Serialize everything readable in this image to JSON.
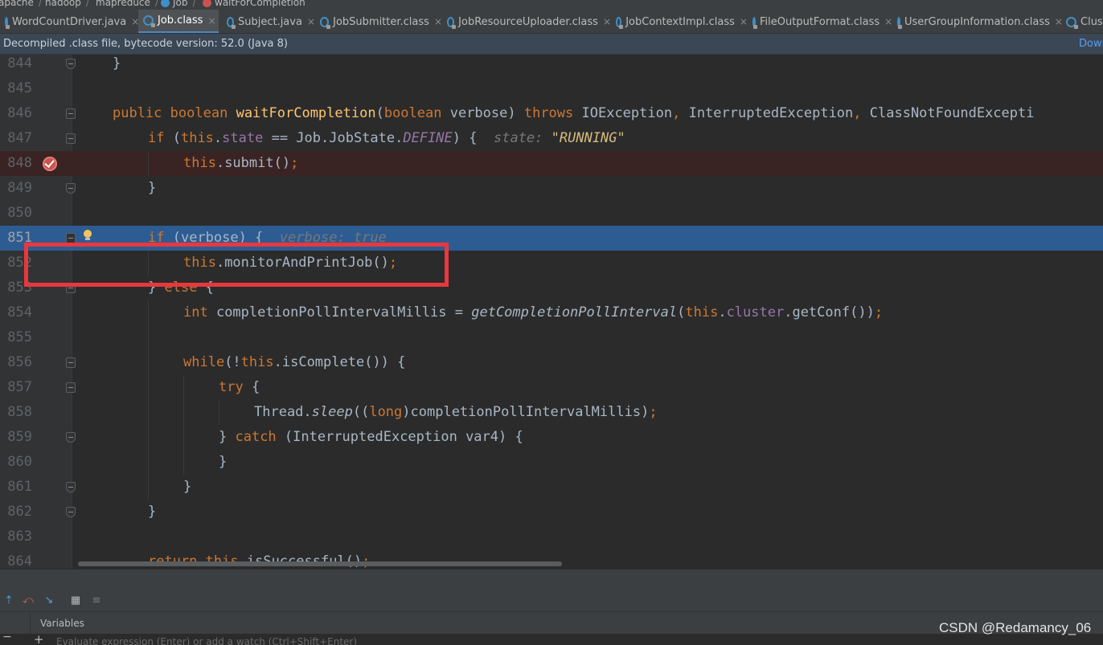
{
  "breadcrumb": {
    "items": [
      "apache",
      "hadoop",
      "mapreduce",
      "Job",
      "waitForCompletion"
    ]
  },
  "tabs": [
    {
      "label": "WordCountDriver.java",
      "active": false
    },
    {
      "label": "Job.class",
      "active": true
    },
    {
      "label": "Subject.java",
      "active": false
    },
    {
      "label": "JobSubmitter.class",
      "active": false
    },
    {
      "label": "JobResourceUploader.class",
      "active": false
    },
    {
      "label": "JobContextImpl.class",
      "active": false
    },
    {
      "label": "FileOutputFormat.class",
      "active": false
    },
    {
      "label": "UserGroupInformation.class",
      "active": false
    },
    {
      "label": "Clus",
      "active": false
    }
  ],
  "tab_close_glyph": "×",
  "infobar": {
    "message": "Decompiled .class file, bytecode version: 52.0 (Java 8)",
    "link": "Down"
  },
  "editor": {
    "line_numbers": [
      "844",
      "845",
      "846",
      "847",
      "848",
      "849",
      "850",
      "851",
      "852",
      "853",
      "854",
      "855",
      "856",
      "857",
      "858",
      "859",
      "860",
      "861",
      "862",
      "863",
      "864"
    ],
    "breakpoint_line": "848",
    "current_line": "851"
  },
  "code": {
    "l844": [
      "}"
    ],
    "l846": [
      "public",
      " ",
      "boolean",
      " ",
      "waitForCompletion",
      "(",
      "boolean",
      " verbose) ",
      "throws",
      " IOException",
      ", ",
      "InterruptedException",
      ", ",
      "ClassNotFoundExcepti"
    ],
    "l847": [
      "if",
      " (",
      "this",
      ".",
      "state",
      " == Job.JobState.",
      "DEFINE",
      ") {",
      "state: ",
      "\"RUNNING\""
    ],
    "l848": [
      "this",
      ".submit()",
      ";"
    ],
    "l849": [
      "}"
    ],
    "l851": [
      "if",
      " (verbose) {",
      "verbose: true"
    ],
    "l852": [
      "this",
      ".monitorAndPrintJob()",
      ";"
    ],
    "l853": [
      "} ",
      "else",
      " {"
    ],
    "l854": [
      "int",
      " completionPollIntervalMillis = ",
      "getCompletionPollInterval",
      "(",
      "this",
      ".",
      "cluster",
      ".getConf())",
      ";"
    ],
    "l856": [
      "while",
      "(!",
      "this",
      ".isComplete()) {"
    ],
    "l857": [
      "try",
      " {"
    ],
    "l858": [
      "Thread.",
      "sleep",
      "((",
      "long",
      ")completionPollIntervalMillis)",
      ";"
    ],
    "l859": [
      "} ",
      "catch",
      " (InterruptedException var4) {"
    ],
    "l860": [
      "}"
    ],
    "l861": [
      "}"
    ],
    "l862": [
      "}"
    ],
    "l864": [
      "return",
      " ",
      "this",
      ".isSuccessful()",
      ";"
    ]
  },
  "debug_panel": {
    "variables_title": "Variables",
    "watch_placeholder": "Evaluate expression (Enter) or add a watch (Ctrl+Shift+Enter)",
    "add_glyph": "+",
    "remove_glyph": "−"
  },
  "watermark": "CSDN @Redamancy_06",
  "colors": {
    "keyword": "#cc7832",
    "method": "#ffc66d",
    "field": "#9876aa",
    "current_line": "#2d5c92",
    "breakpoint_line": "#3a2323",
    "annotation_box": "#e8383d"
  }
}
